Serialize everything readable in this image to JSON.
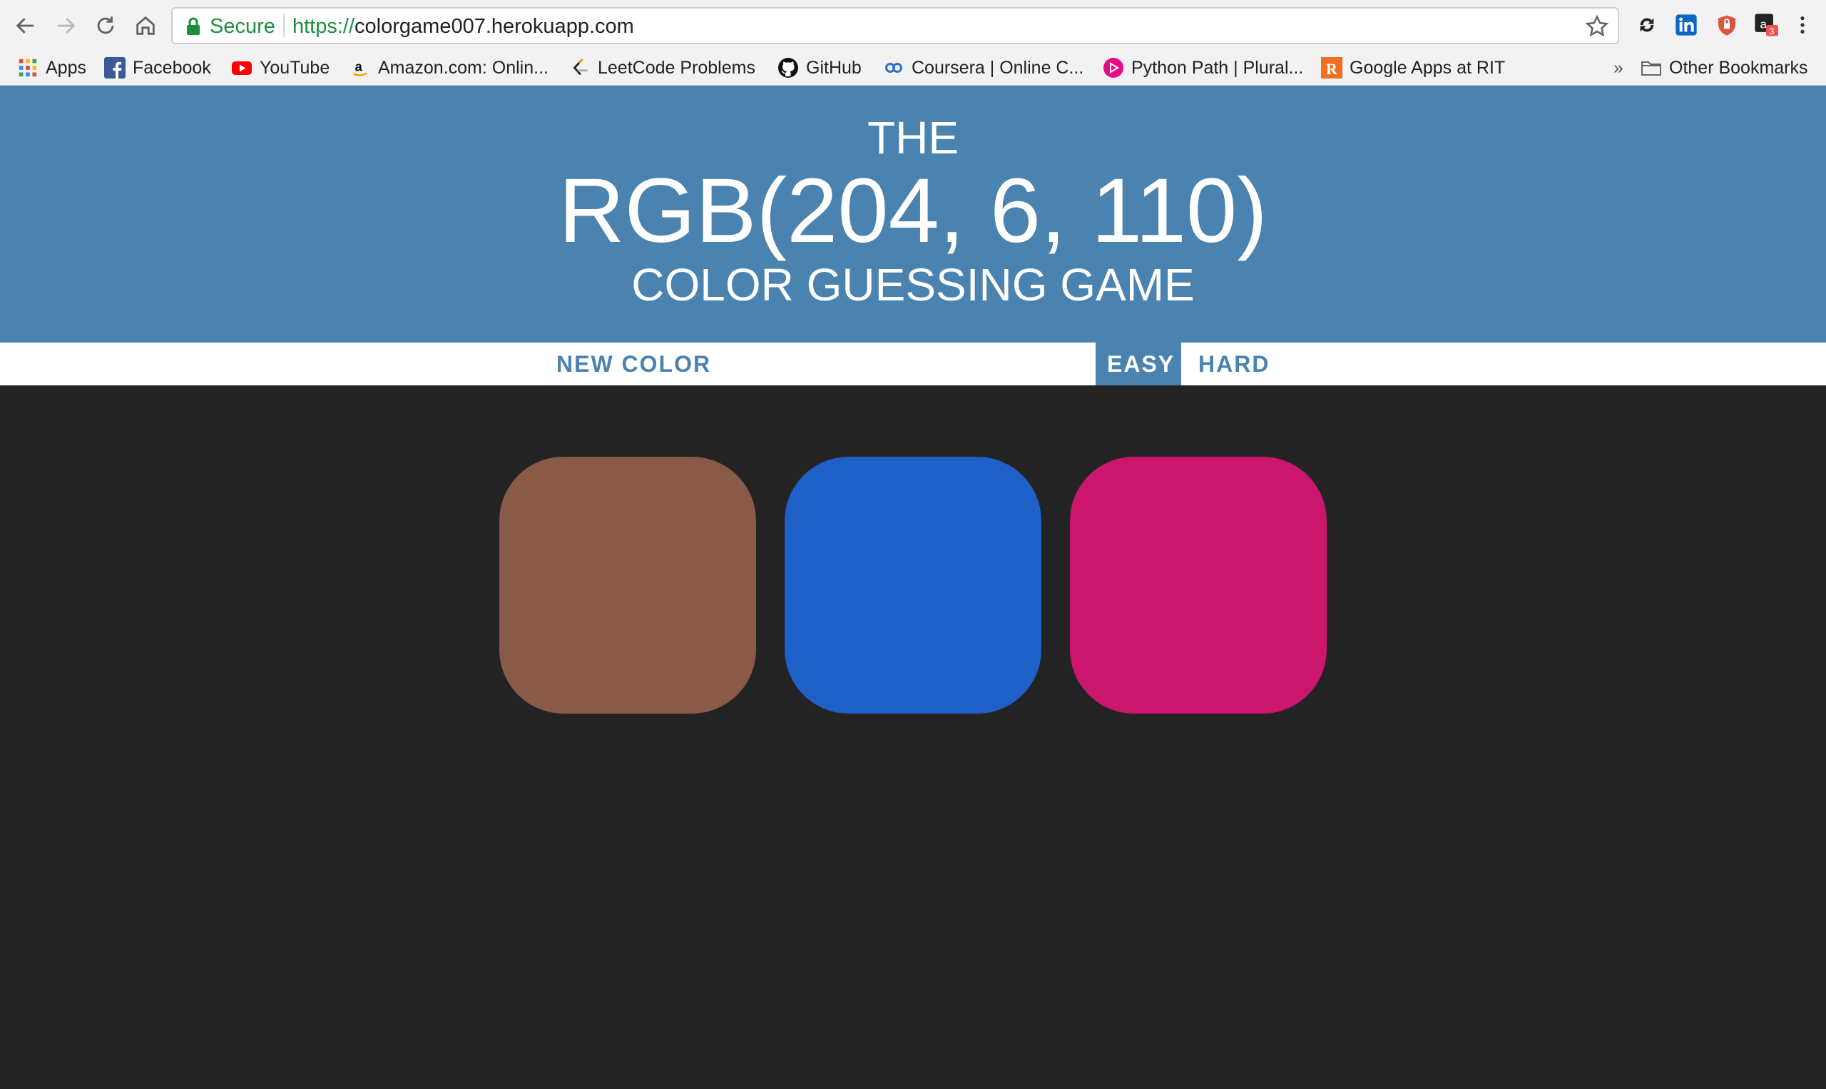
{
  "browser": {
    "secure_label": "Secure",
    "url_scheme": "https://",
    "url_rest": "colorgame007.herokuapp.com",
    "extension_badge": "3",
    "bookmarks": [
      {
        "label": "Apps",
        "icon": "apps-grid-icon"
      },
      {
        "label": "Facebook",
        "icon": "facebook-icon"
      },
      {
        "label": "YouTube",
        "icon": "youtube-icon"
      },
      {
        "label": "Amazon.com: Onlin...",
        "icon": "amazon-icon"
      },
      {
        "label": "LeetCode Problems",
        "icon": "leetcode-icon"
      },
      {
        "label": "GitHub",
        "icon": "github-icon"
      },
      {
        "label": "Coursera | Online C...",
        "icon": "coursera-icon"
      },
      {
        "label": "Python Path | Plural...",
        "icon": "pluralsight-icon"
      },
      {
        "label": "Google Apps at RIT",
        "icon": "rit-icon"
      }
    ],
    "overflow": "»",
    "other_bookmarks": "Other Bookmarks"
  },
  "game": {
    "title_top": "THE",
    "rgb_display": "RGB(204, 6, 110)",
    "title_bottom": "COLOR GUESSING GAME",
    "new_color_label": "NEW COLOR",
    "easy_label": "EASY",
    "hard_label": "HARD",
    "selected_mode": "EASY",
    "header_color": "#4a82b0",
    "background_color": "#232323",
    "squares": [
      {
        "color": "#8a5a48"
      },
      {
        "color": "#1e5fc8"
      },
      {
        "color": "#cc166e"
      }
    ]
  }
}
